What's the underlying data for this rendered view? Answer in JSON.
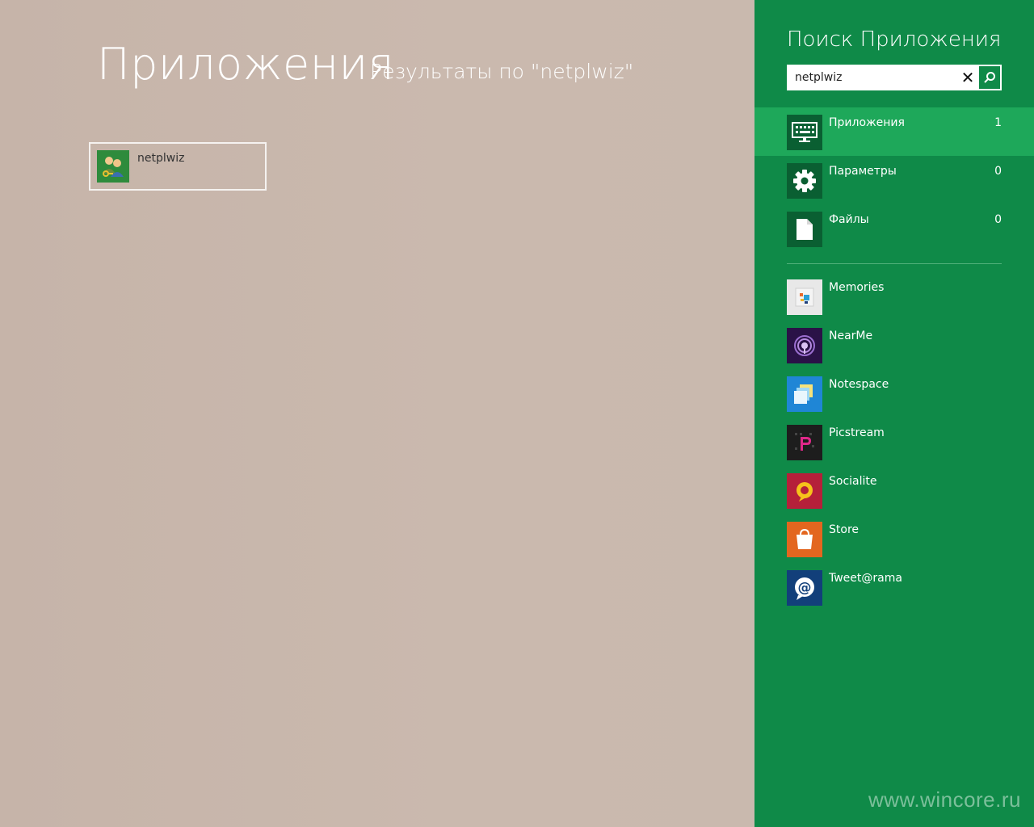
{
  "main": {
    "title": "Приложения",
    "subtitle": "Результаты по \"netplwiz\"",
    "results": [
      {
        "label": "netplwiz",
        "icon": "users-keys-icon"
      }
    ]
  },
  "charm": {
    "title": "Поиск Приложения",
    "search": {
      "value": "netplwiz",
      "placeholder": ""
    },
    "scopes": [
      {
        "label": "Приложения",
        "count": "1",
        "icon": "keyboard-monitor-icon",
        "selected": true
      },
      {
        "label": "Параметры",
        "count": "0",
        "icon": "gear-icon",
        "selected": false
      },
      {
        "label": "Файлы",
        "count": "0",
        "icon": "file-icon",
        "selected": false
      }
    ],
    "apps": [
      {
        "label": "Memories",
        "icon": "memories-icon",
        "color": "#e8e8e8"
      },
      {
        "label": "NearMe",
        "icon": "nearme-icon",
        "color": "#2a1247"
      },
      {
        "label": "Notespace",
        "icon": "notespace-icon",
        "color": "#1f86d6"
      },
      {
        "label": "Picstream",
        "icon": "picstream-icon",
        "color": "#1d1d1d"
      },
      {
        "label": "Socialite",
        "icon": "socialite-icon",
        "color": "#b5203a"
      },
      {
        "label": "Store",
        "icon": "store-icon",
        "color": "#e3661f"
      },
      {
        "label": "Tweet@rama",
        "icon": "tweetarama-icon",
        "color": "#123f7a"
      }
    ]
  },
  "watermark": "www.wincore.ru"
}
